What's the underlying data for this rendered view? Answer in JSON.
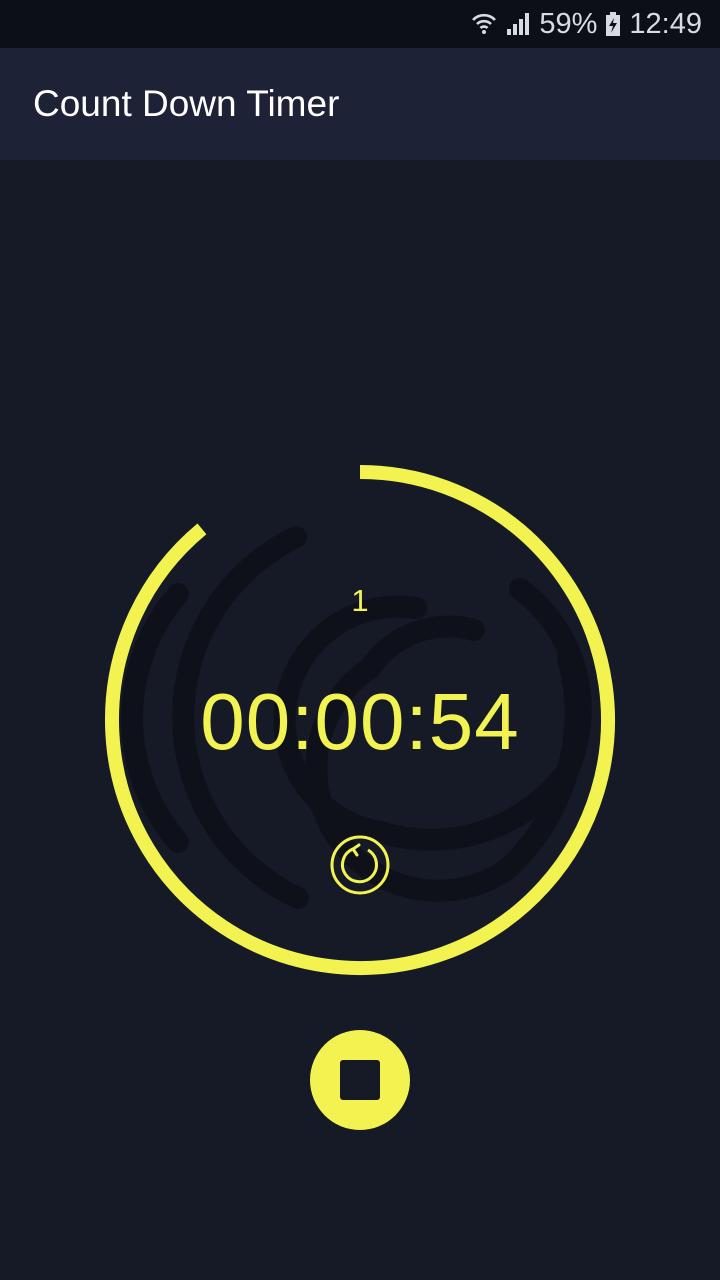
{
  "status_bar": {
    "battery": "59%",
    "time": "12:49",
    "icons": [
      "wifi-icon",
      "signal-icon",
      "battery-charging-icon"
    ]
  },
  "app_bar": {
    "title": "Count Down Timer"
  },
  "timer": {
    "round": "1",
    "time": "00:00:54",
    "remaining_fraction": 0.89,
    "reset_icon": "reset-icon"
  },
  "controls": {
    "stop_icon": "stop-icon"
  },
  "colors": {
    "accent": "#f2f350",
    "background": "#161a26",
    "app_bar": "#1e2236",
    "status_bar": "#0c0f17",
    "fingerprint": "#0e111a"
  }
}
